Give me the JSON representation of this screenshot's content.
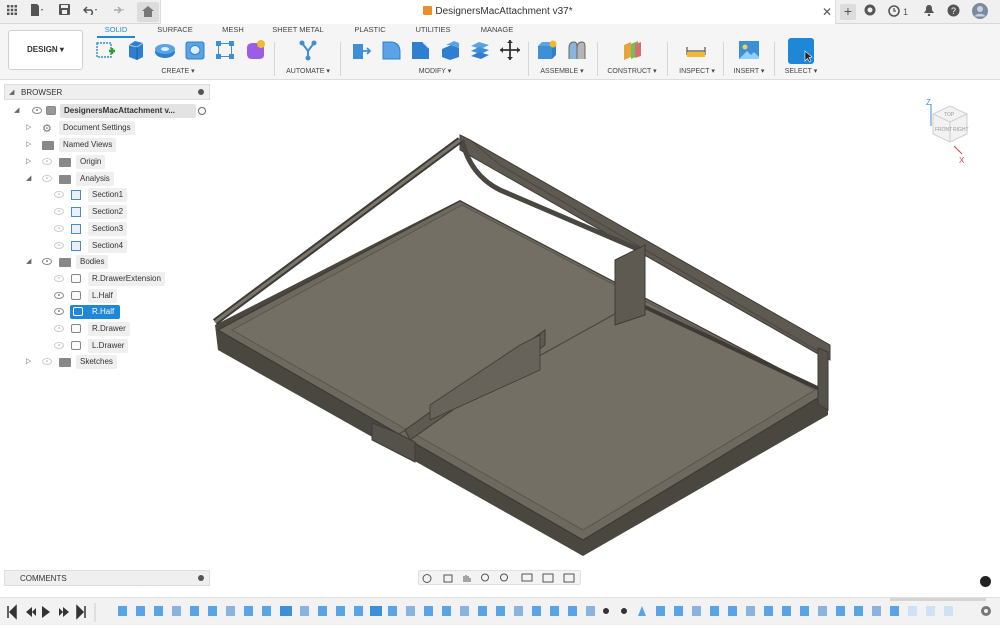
{
  "titlebar": {
    "document_title": "DesignersMacAttachment v37*",
    "job_count": "1"
  },
  "toolbar": {
    "workspace_button": "DESIGN ▾",
    "tabs": [
      "SOLID",
      "SURFACE",
      "MESH",
      "SHEET METAL",
      "PLASTIC",
      "UTILITIES",
      "MANAGE"
    ],
    "active_tab": "SOLID",
    "groups": [
      "CREATE ▾",
      "AUTOMATE ▾",
      "MODIFY ▾",
      "ASSEMBLE ▾",
      "CONSTRUCT ▾",
      "INSPECT ▾",
      "INSERT ▾",
      "SELECT ▾"
    ]
  },
  "browser": {
    "header": "BROWSER",
    "root": "DesignersMacAttachment v...",
    "items": [
      {
        "label": "Document Settings"
      },
      {
        "label": "Named Views"
      },
      {
        "label": "Origin"
      },
      {
        "label": "Analysis"
      },
      {
        "label": "Section1"
      },
      {
        "label": "Section2"
      },
      {
        "label": "Section3"
      },
      {
        "label": "Section4"
      },
      {
        "label": "Bodies"
      },
      {
        "label": "R.DrawerExtension"
      },
      {
        "label": "L.Half"
      },
      {
        "label": "R.Half"
      },
      {
        "label": "R.Drawer"
      },
      {
        "label": "L.Drawer"
      },
      {
        "label": "Sketches"
      }
    ],
    "selected": "R.Half"
  },
  "comments": {
    "label": "COMMENTS"
  },
  "viewcube": {
    "axis_z": "Z",
    "axis_x": "X",
    "face_top": "TOP",
    "face_front": "FRONT",
    "face_right": "RIGHT"
  },
  "colors": {
    "accent": "#1e88d6",
    "model": "#6a665e",
    "model_edge": "#3e3b36"
  },
  "icons": [
    "grid-icon",
    "file-icon",
    "save-icon",
    "undo-icon",
    "redo-icon",
    "home-icon",
    "close-icon",
    "new-tab-icon",
    "extensions-icon",
    "job-status-icon",
    "notifications-icon",
    "help-icon",
    "user-avatar-icon"
  ]
}
